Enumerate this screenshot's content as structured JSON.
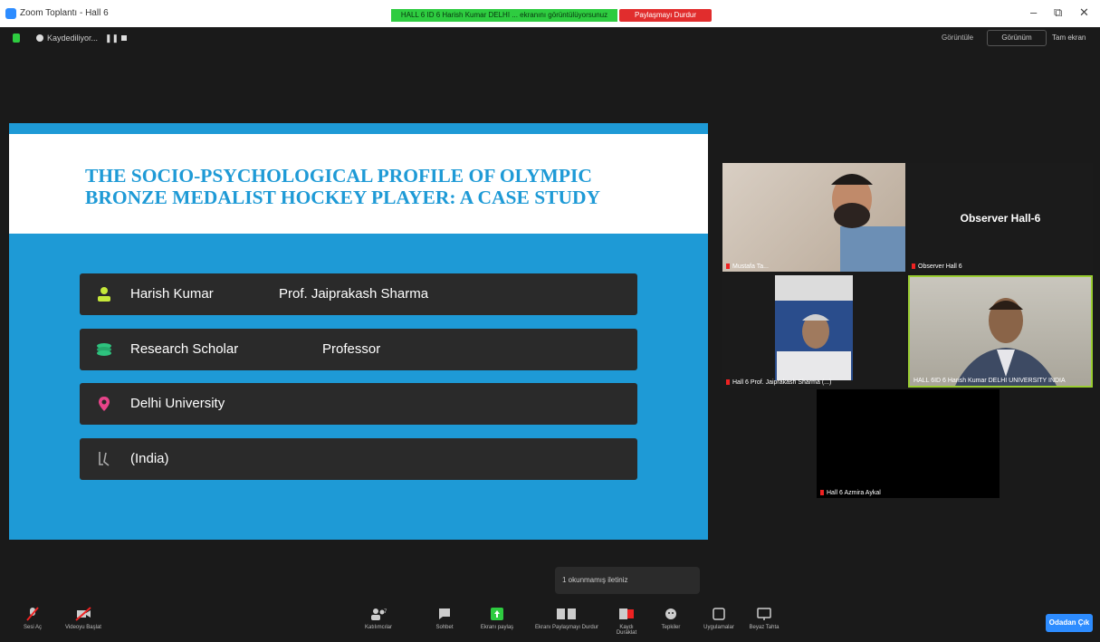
{
  "window": {
    "title": "Zoom Toplantı - Hall 6",
    "share_banner": "HALL 6 ID 6 Harish Kumar DELHI ... ekranını görüntülüyorsunuz",
    "stop_share": "Paylaşmayı Durdur",
    "controls": [
      "–",
      "⧉",
      "✕"
    ]
  },
  "meeting_bar": {
    "recording_label": "Kaydediliyor...",
    "pause_glyph": "❚❚",
    "speaker_view_label": "Görüntüle",
    "view_dropdown": "Görünüm",
    "fullscreen_label": "Tam ekran"
  },
  "slide": {
    "title_line1": "THE SOCIO-PSYCHOLOGICAL PROFILE OF OLYMPIC",
    "title_line2": "BRONZE MEDALIST HOCKEY PLAYER: A CASE STUDY",
    "rows": [
      {
        "icon": "person-icon",
        "col1": "Harish Kumar",
        "col2": "Prof. Jaiprakash Sharma"
      },
      {
        "icon": "books-icon",
        "col1": "Research Scholar",
        "col2": "Professor"
      },
      {
        "icon": "location-pin-icon",
        "col1": "Delhi University",
        "col2": ""
      },
      {
        "icon": "hockey-icon",
        "col1": "(India)",
        "col2": ""
      }
    ],
    "colors": {
      "accent": "#1e9ad6",
      "row_bg": "#2a2a2a"
    }
  },
  "tiles": {
    "t1_name": "Mustafa Ta...",
    "observer_label": "Observer Hall-6",
    "t2_name": "Observer Hall 6",
    "t3_name": "Hall 6 Prof. Jaiprakash Sharma (...)",
    "t4_name": "HALL 6ID 6 Harish Kumar DELHI UNIVERSITY INDIA",
    "t5_name": "Hall 6 Azmira Aykal"
  },
  "chat_toast": "1 okunmamış iletiniz",
  "toolbar": {
    "mute": "Sesi Aç",
    "video": "Videoyu Başlat",
    "participants": "Katılımcılar",
    "participants_count": "7",
    "chat": "Sohbet",
    "share": "Ekranı paylaş",
    "pause_share": "Ekranı Paylaşmayı Durdur",
    "record": "Kaydı Duraklat",
    "reactions": "Tepkiler",
    "apps": "Uygulamalar",
    "whiteboard": "Beyaz Tahta",
    "end": "Odadan Çık"
  }
}
